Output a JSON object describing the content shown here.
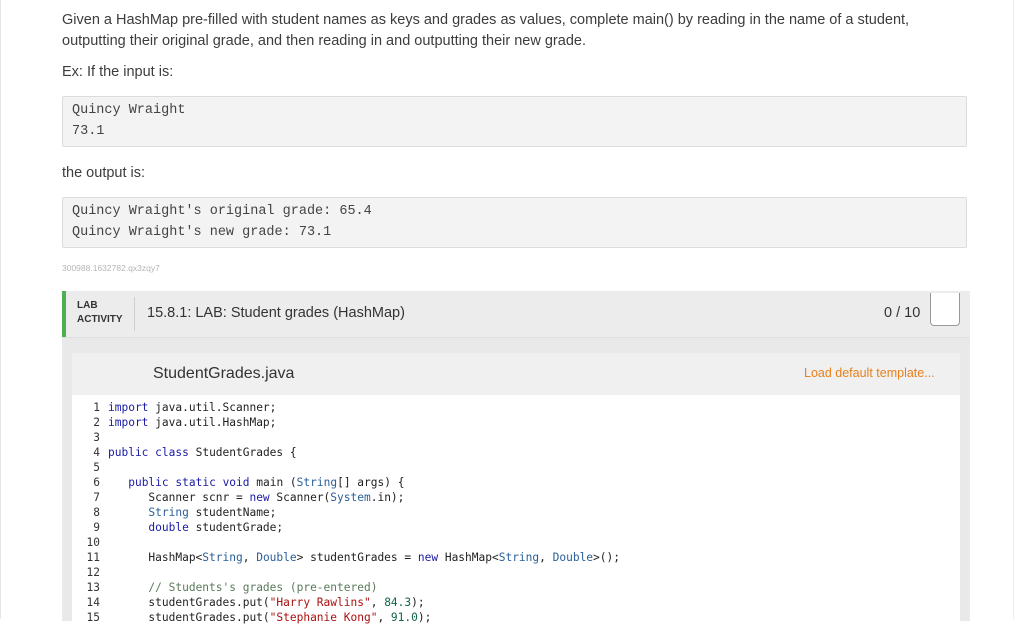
{
  "description": {
    "p1": "Given a HashMap pre-filled with student names as keys and grades as values, complete main() by reading in the name of a student, outputting their original grade, and then reading in and outputting their new grade.",
    "p2": "Ex: If the input is:",
    "input_lines": [
      "Quincy Wraight",
      "73.1"
    ],
    "p3": "the output is:",
    "output_lines": [
      "Quincy Wraight's original grade: 65.4",
      "Quincy Wraight's new grade: 73.1"
    ],
    "identifier": "300988.1632782.qx3zqy7"
  },
  "lab": {
    "tag_line1": "LAB",
    "tag_line2": "ACTIVITY",
    "title": "15.8.1: LAB: Student grades (HashMap)",
    "score": "0 / 10",
    "accent_color": "#4caf50"
  },
  "editor": {
    "file_name": "StudentGrades.java",
    "load_template": "Load default template...",
    "code_lines": [
      "import java.util.Scanner;",
      "import java.util.HashMap;",
      "",
      "public class StudentGrades {",
      "",
      "   public static void main (String[] args) {",
      "      Scanner scnr = new Scanner(System.in);",
      "      String studentName;",
      "      double studentGrade;",
      "",
      "      HashMap<String, Double> studentGrades = new HashMap<String, Double>();",
      "",
      "      // Students's grades (pre-entered)",
      "      studentGrades.put(\"Harry Rawlins\", 84.3);",
      "      studentGrades.put(\"Stephanie Kong\", 91.0);"
    ]
  }
}
